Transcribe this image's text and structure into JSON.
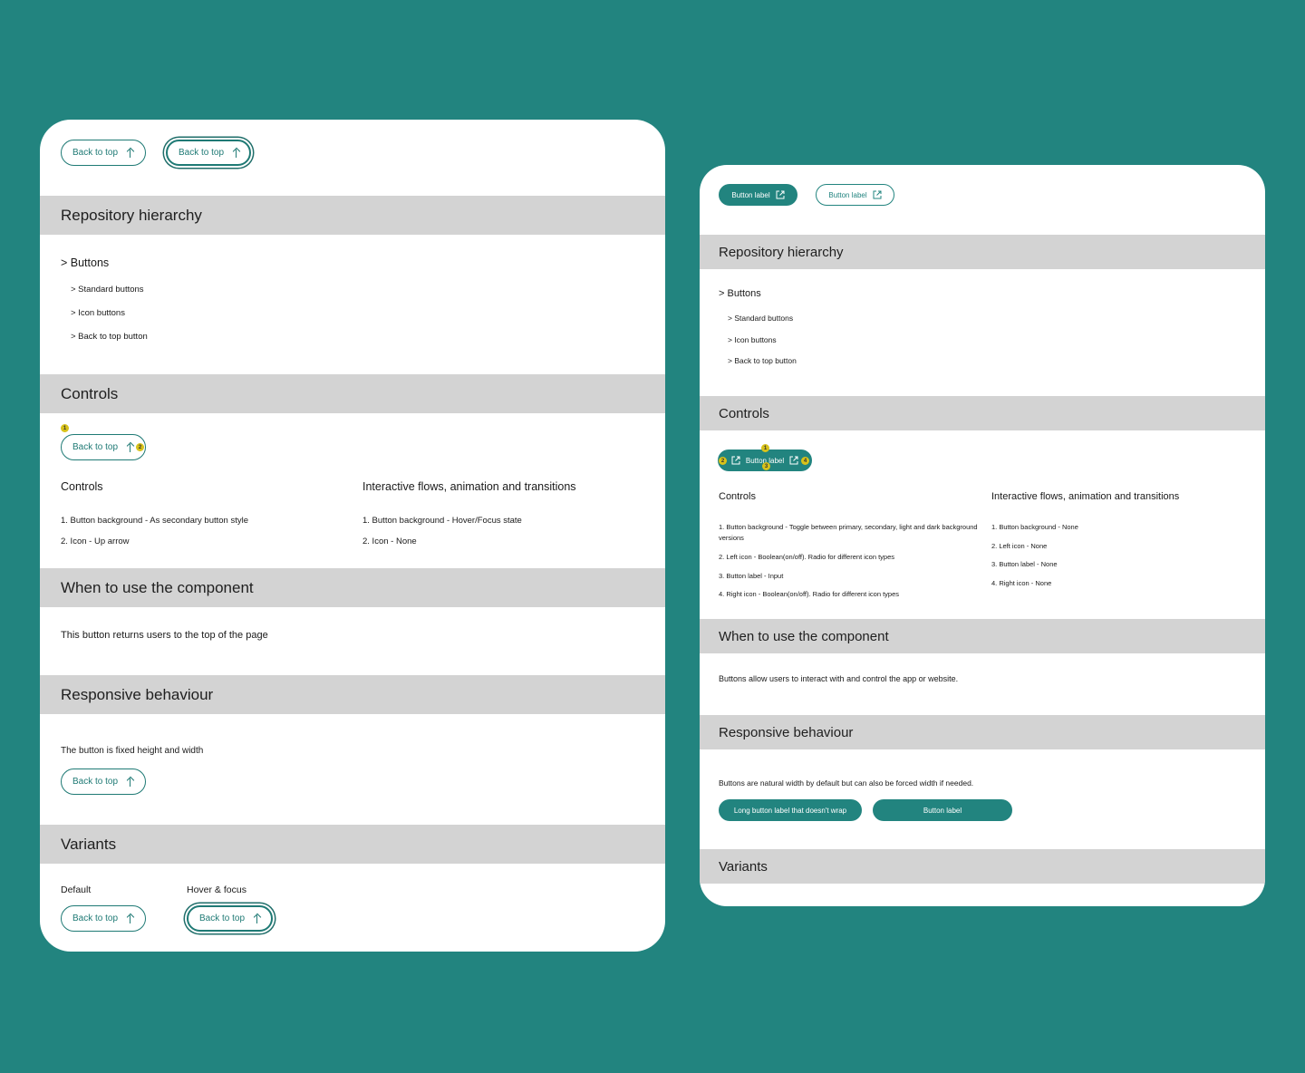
{
  "colors": {
    "background": "#22847f",
    "accent": "#1f7a75",
    "section_band": "#d3d3d3",
    "marker": "#d8c21a"
  },
  "left": {
    "top_buttons": {
      "default": "Back to top",
      "focus": "Back to top"
    },
    "repo": {
      "heading": "Repository hierarchy",
      "root": "> Buttons",
      "items": [
        "> Standard buttons",
        "> Icon buttons",
        "> Back to top button"
      ]
    },
    "controls": {
      "heading": "Controls",
      "example_button": "Back to top",
      "markers": [
        "1",
        "2"
      ],
      "col1_title": "Controls",
      "col1_items": [
        "1. Button background - As secondary button style",
        "2. Icon - Up arrow"
      ],
      "col2_title": "Interactive flows, animation and transitions",
      "col2_items": [
        "1. Button background - Hover/Focus state",
        "2. Icon - None"
      ]
    },
    "when": {
      "heading": "When to use the component",
      "text": "This button returns users to the top of the page"
    },
    "responsive": {
      "heading": "Responsive behaviour",
      "text": "The button is fixed height and width",
      "button": "Back to top"
    },
    "variants": {
      "heading": "Variants",
      "default_label": "Default",
      "hover_label": "Hover & focus",
      "default_button": "Back to top",
      "hover_button": "Back to top"
    }
  },
  "right": {
    "top_buttons": {
      "primary": "Button label",
      "secondary": "Button label"
    },
    "repo": {
      "heading": "Repository hierarchy",
      "root": "> Buttons",
      "items": [
        "> Standard buttons",
        "> Icon buttons",
        "> Back to top button"
      ]
    },
    "controls": {
      "heading": "Controls",
      "example_button": "Button label",
      "markers": [
        "1",
        "2",
        "3",
        "4"
      ],
      "col1_title": "Controls",
      "col1_items": [
        "1. Button background - Toggle between primary, secondary, light and dark background versions",
        "2. Left icon - Boolean(on/off). Radio for different icon types",
        "3. Button label - Input",
        "4. Right icon - Boolean(on/off). Radio for different icon types"
      ],
      "col2_title": "Interactive flows, animation and transitions",
      "col2_items": [
        "1. Button background - None",
        "2. Left icon - None",
        "3. Button label - None",
        "4. Right icon - None"
      ]
    },
    "when": {
      "heading": "When to use the component",
      "text": "Buttons allow users to interact with and control the app or website."
    },
    "responsive": {
      "heading": "Responsive behaviour",
      "text": "Buttons are natural width by default but can also be forced width if needed.",
      "long_button": "Long button label that doesn't wrap",
      "short_button": "Button label"
    },
    "variants": {
      "heading": "Variants"
    }
  }
}
